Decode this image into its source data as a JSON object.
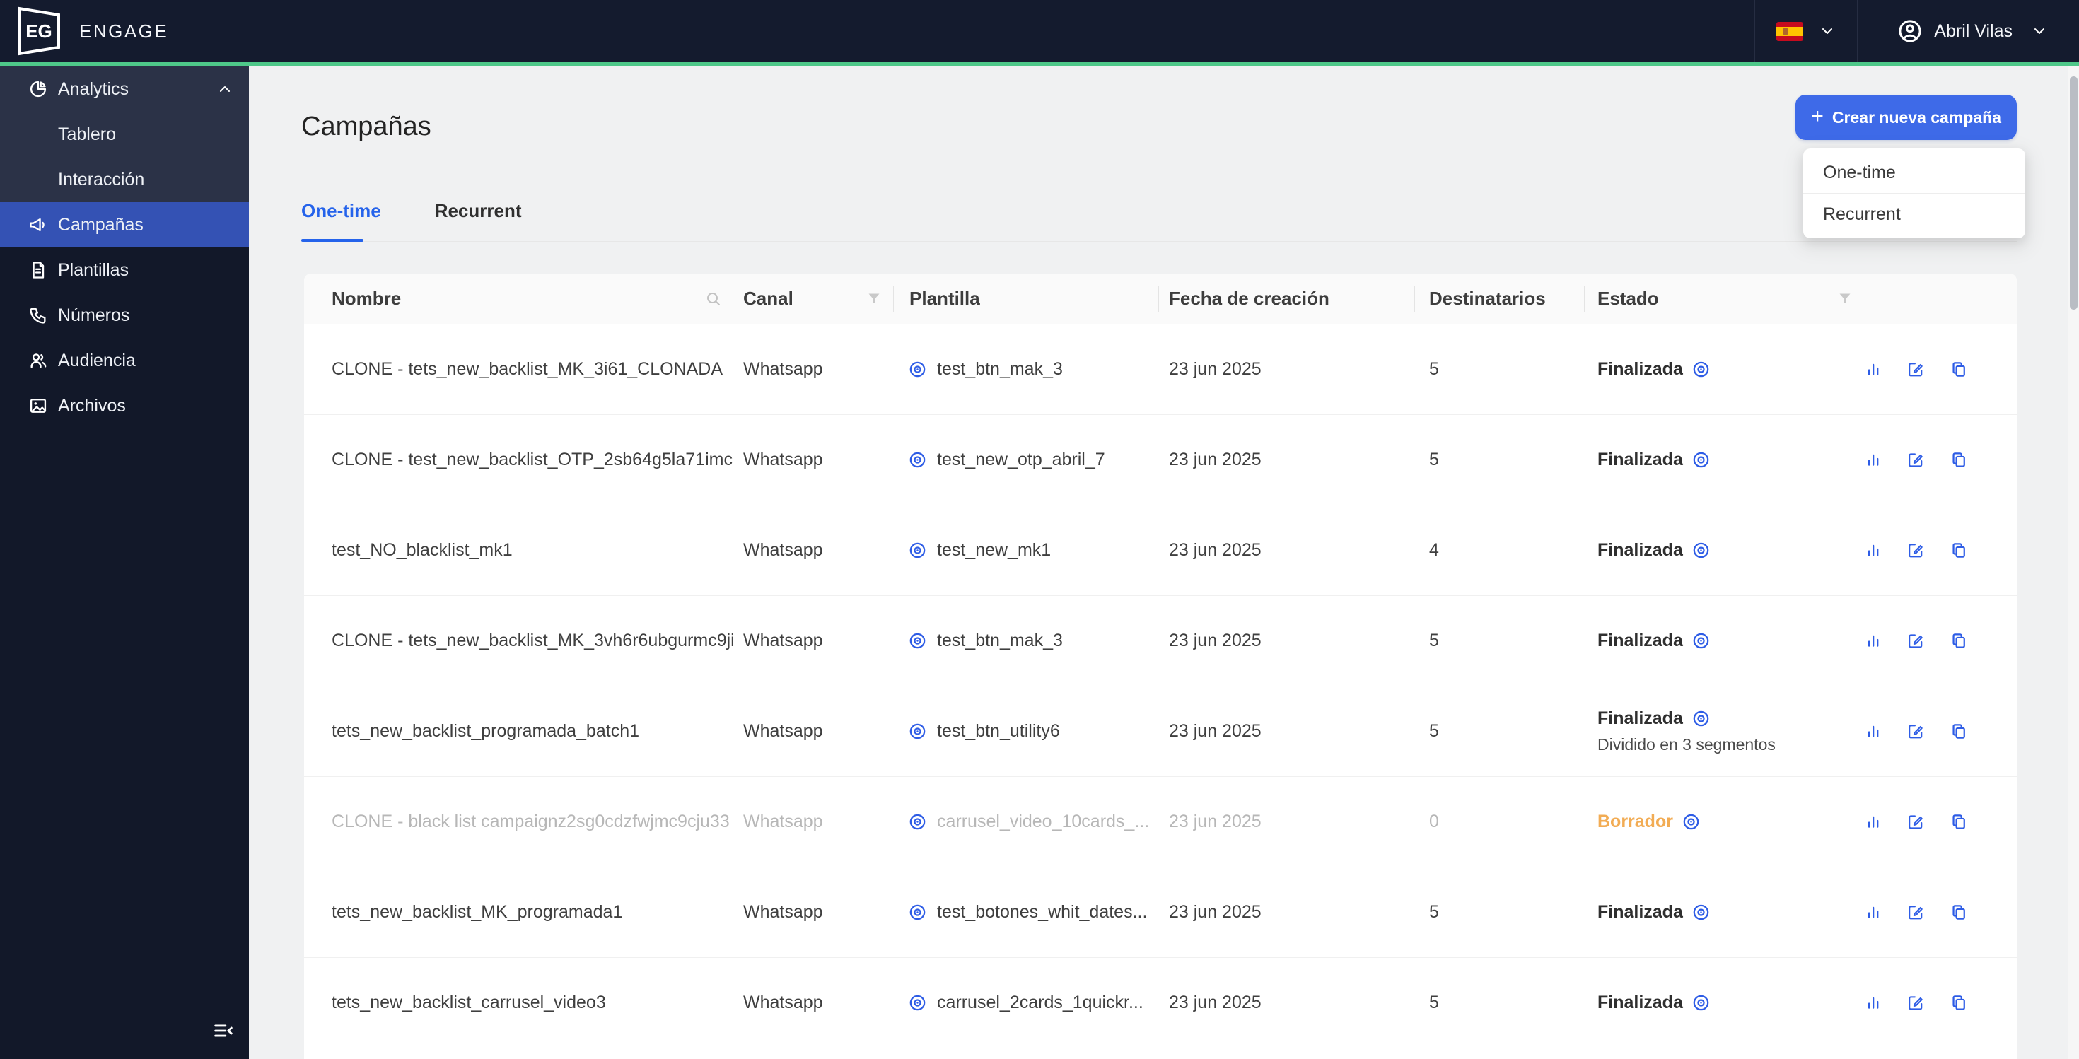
{
  "brand": {
    "logo_monogram": "EG",
    "name": "ENGAGE"
  },
  "topbar": {
    "language": {
      "flag": "spain-flag"
    },
    "user": {
      "name": "Abril Vilas"
    }
  },
  "sidebar": {
    "items": [
      {
        "label": "Analytics",
        "icon": "pie-chart-icon",
        "expanded": true
      },
      {
        "label": "Tablero"
      },
      {
        "label": "Interacción"
      },
      {
        "label": "Campañas",
        "icon": "megaphone-icon",
        "active": true
      },
      {
        "label": "Plantillas",
        "icon": "document-icon"
      },
      {
        "label": "Números",
        "icon": "phone-icon"
      },
      {
        "label": "Audiencia",
        "icon": "people-icon"
      },
      {
        "label": "Archivos",
        "icon": "image-icon"
      }
    ]
  },
  "page": {
    "title": "Campañas",
    "create_button_label": "Crear nueva campaña",
    "create_button_plus": "+",
    "create_menu": {
      "items": [
        {
          "label": "One-time"
        },
        {
          "label": "Recurrent"
        }
      ]
    },
    "tabs": [
      {
        "label": "One-time",
        "active": true
      },
      {
        "label": "Recurrent",
        "active": false
      }
    ]
  },
  "table": {
    "headers": {
      "nombre": "Nombre",
      "canal": "Canal",
      "plantilla": "Plantilla",
      "fecha": "Fecha de creación",
      "destinatarios": "Destinatarios",
      "estado": "Estado"
    },
    "rows": [
      {
        "nombre": "CLONE - tets_new_backlist_MK_3i61_CLONADA",
        "canal": "Whatsapp",
        "plantilla": "test_btn_mak_3",
        "fecha": "23 jun 2025",
        "destinatarios": "5",
        "estado": "Finalizada",
        "estado_tipo": "finalizada",
        "acciones": [
          "stats",
          "copy"
        ]
      },
      {
        "nombre": "CLONE - test_new_backlist_OTP_2sb64g5la71imc...",
        "canal": "Whatsapp",
        "plantilla": "test_new_otp_abril_7",
        "fecha": "23 jun 2025",
        "destinatarios": "5",
        "estado": "Finalizada",
        "estado_tipo": "finalizada",
        "acciones": [
          "stats",
          "copy"
        ]
      },
      {
        "nombre": "test_NO_blacklist_mk1",
        "canal": "Whatsapp",
        "plantilla": "test_new_mk1",
        "fecha": "23 jun 2025",
        "destinatarios": "4",
        "estado": "Finalizada",
        "estado_tipo": "finalizada",
        "acciones": [
          "stats",
          "copy"
        ]
      },
      {
        "nombre": "CLONE - tets_new_backlist_MK_3vh6r6ubgurmc9ji...",
        "canal": "Whatsapp",
        "plantilla": "test_btn_mak_3",
        "fecha": "23 jun 2025",
        "destinatarios": "5",
        "estado": "Finalizada",
        "estado_tipo": "finalizada",
        "acciones": [
          "stats",
          "copy"
        ]
      },
      {
        "nombre": "tets_new_backlist_programada_batch1",
        "canal": "Whatsapp",
        "plantilla": "test_btn_utility6",
        "fecha": "23 jun 2025",
        "destinatarios": "5",
        "estado": "Finalizada",
        "estado_tipo": "finalizada",
        "estado_eye": true,
        "estado_sub": "Dividido en 3 segmentos",
        "acciones": [
          "stats",
          "copy"
        ]
      },
      {
        "nombre": "CLONE - black list campaignz2sg0cdzfwjmc9cju33",
        "canal": "Whatsapp",
        "plantilla": "carrusel_video_10cards_...",
        "fecha": "23 jun 2025",
        "destinatarios": "0",
        "estado": "Borrador",
        "estado_tipo": "borrador",
        "muted": true,
        "acciones": [
          "edit",
          "copy"
        ]
      },
      {
        "nombre": "tets_new_backlist_MK_programada1",
        "canal": "Whatsapp",
        "plantilla": "test_botones_whit_dates...",
        "fecha": "23 jun 2025",
        "destinatarios": "5",
        "estado": "Finalizada",
        "estado_tipo": "finalizada",
        "acciones": [
          "stats",
          "copy"
        ]
      },
      {
        "nombre": "tets_new_backlist_carrusel_video3",
        "canal": "Whatsapp",
        "plantilla": "carrusel_2cards_1quickr...",
        "fecha": "23 jun 2025",
        "destinatarios": "5",
        "estado": "Finalizada",
        "estado_tipo": "finalizada",
        "acciones": [
          "stats",
          "copy"
        ]
      }
    ]
  },
  "colors": {
    "topbar_bg": "#141b2e",
    "sidebar_bg": "#121829",
    "sidebar_group_bg": "#2b3247",
    "active_nav_blue": "#3452b4",
    "accent_green": "#4ec889",
    "primary_button_blue": "#3e6ae8",
    "tab_active_blue": "#2563eb",
    "icon_blue": "#2d5ce6",
    "draft_orange": "#f2ac54"
  }
}
